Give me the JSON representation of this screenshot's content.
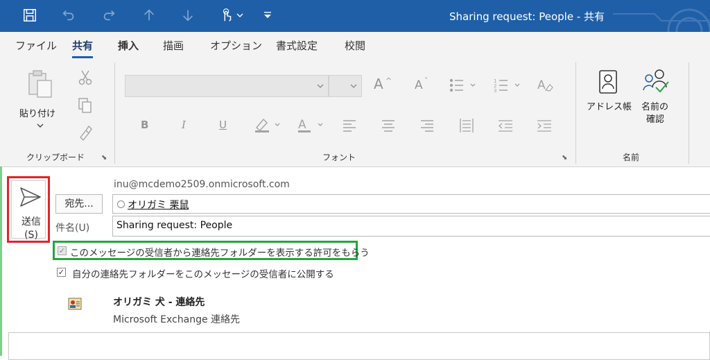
{
  "window": {
    "title": "Sharing request: People  -  共有"
  },
  "menu": {
    "tabs": [
      {
        "label": "ファイル"
      },
      {
        "label": "共有"
      },
      {
        "label": "挿入"
      },
      {
        "label": "描画"
      },
      {
        "label": "オプション"
      },
      {
        "label": "書式設定"
      },
      {
        "label": "校閲"
      }
    ]
  },
  "ribbon": {
    "clipboard": {
      "paste_label": "貼り付け",
      "group_label": "クリップボード"
    },
    "font": {
      "group_label": "フォント",
      "bold": "B",
      "italic": "I",
      "underline": "U",
      "grow_font": "A",
      "shrink_font": "A"
    },
    "names": {
      "address_book_label": "アドレス帳",
      "check_names_label_1": "名前の",
      "check_names_label_2": "確認",
      "group_label": "名前"
    }
  },
  "compose": {
    "send_label_1": "送信",
    "send_label_2": "(S)",
    "from": "inu@mcdemo2509.onmicrosoft.com",
    "to_button": "宛先...",
    "recipient": "オリガミ 栗鼠",
    "subject_label": "件名(U)",
    "subject_value": "Sharing request: People",
    "option_request": {
      "label": "このメッセージの受信者から連絡先フォルダーを表示する許可をもらう",
      "checked": true
    },
    "option_share": {
      "label": "自分の連絡先フォルダーをこのメッセージの受信者に公開する",
      "checked": true
    },
    "attachment": {
      "name": "オリガミ 犬 - 連絡先",
      "subtitle": "Microsoft Exchange 連絡先",
      "icon": "contact-card-icon"
    }
  },
  "colors": {
    "titlebar": "#1f5fa8",
    "send_highlight": "#e0242a",
    "option_highlight": "#22a83a"
  }
}
